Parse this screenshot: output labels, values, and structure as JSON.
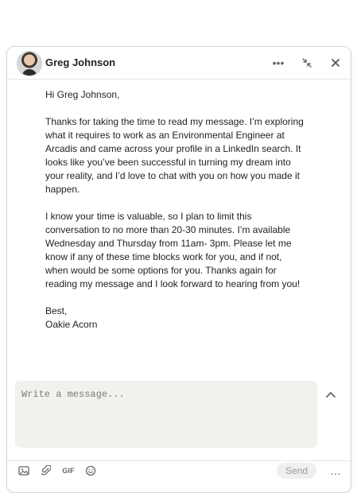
{
  "header": {
    "name": "Greg Johnson"
  },
  "message": {
    "text": "Hi Greg Johnson,\n\nThanks for taking the time to read my message. I’m exploring what it requires to work as an Environmental Engineer at Arcadis and came across your profile in a LinkedIn search. It looks like you’ve been successful in turning my dream into your reality, and I’d love to chat with you on how you made it happen.\n\nI know your time is valuable, so I plan to limit this conversation to no more than 20-30 minutes. I’m available Wednesday and Thursday from 11am- 3pm. Please let me know if any of these time blocks work for you, and if not, when would be some options for you. Thanks again for reading my message and I look forward to hearing from you!\n\nBest,\nOakie Acorn"
  },
  "compose": {
    "placeholder": "Write a message..."
  },
  "toolbar": {
    "gif_label": "GIF",
    "send_label": "Send",
    "more_label": "…"
  },
  "icons": {
    "header_more": "more-horizontal",
    "minimize": "collapse-arrows",
    "close": "close-x",
    "expand": "chevron-up",
    "image": "image-icon",
    "attach": "paperclip-icon",
    "emoji": "emoji-icon"
  }
}
